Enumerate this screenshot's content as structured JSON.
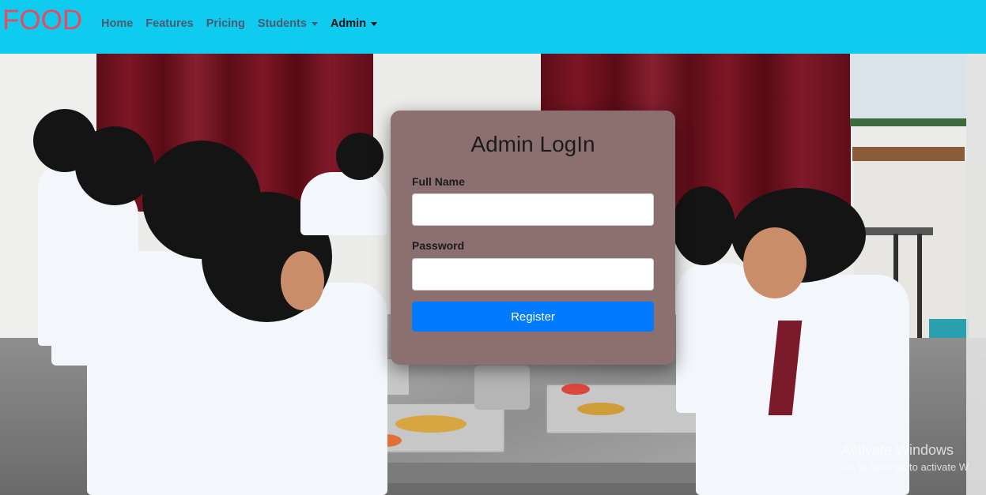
{
  "navbar": {
    "brand": "FOOD",
    "items": [
      {
        "label": "Home"
      },
      {
        "label": "Features"
      },
      {
        "label": "Pricing"
      },
      {
        "label": "Students"
      },
      {
        "label": "Admin"
      }
    ],
    "bg_color": "#0fcbf0",
    "brand_color": "#e84a5f"
  },
  "login": {
    "title": "Admin LogIn",
    "full_name_label": "Full Name",
    "full_name_value": "",
    "password_label": "Password",
    "password_value": "",
    "submit_label": "Register",
    "card_color": "#8c7070",
    "button_color": "#007bff"
  },
  "watermark": {
    "line1": "Activate Windows",
    "line2": "Go to Settings to activate W"
  },
  "icons": [
    "dropdown-caret-icon"
  ]
}
